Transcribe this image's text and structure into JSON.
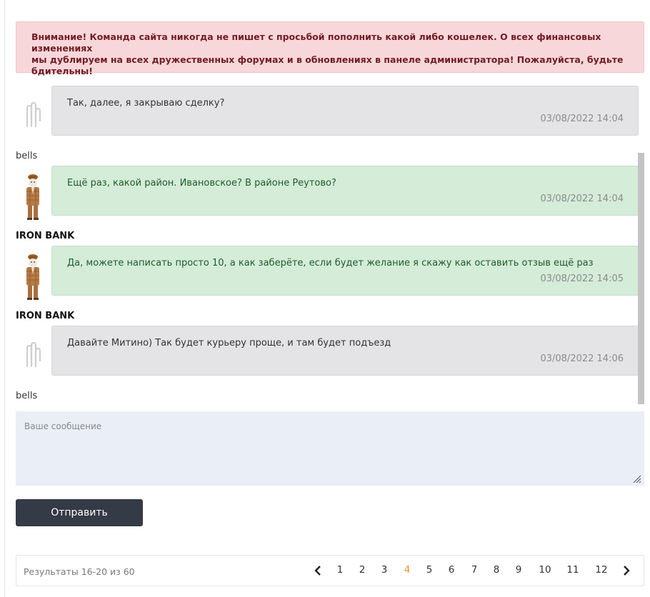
{
  "alert": {
    "line1": "Внимание! Команда сайта никогда не пишет с просьбой пополнить какой либо кошелек. О всех финансовых изменениях",
    "line2": "мы дублируем на всех дружественных форумах и в обновлениях в панеле администратора! Пожалуйста, будьте",
    "line3": "бдительны!"
  },
  "messages": [
    {
      "text": "Так, далее, я закрываю сделку?",
      "time": "03/08/2022 14:04",
      "author": "bells",
      "style": "grey"
    },
    {
      "text": "Ещё раз, какой район. Ивановское? В районе Реутово?",
      "time": "03/08/2022 14:04",
      "author": "IRON BANK",
      "style": "green"
    },
    {
      "text": "Да, можете написать просто 10, а как заберёте, если будет желание я скажу как оставить отзыв ещё раз",
      "time": "03/08/2022 14:05",
      "author": "IRON BANK",
      "style": "green"
    },
    {
      "text": "Давайте Митино) Так будет курьеру проще, и там будет подъезд",
      "time": "03/08/2022 14:06",
      "author": "bells",
      "style": "grey"
    }
  ],
  "composer": {
    "placeholder": "Ваше сообщение",
    "send_label": "Отправить"
  },
  "pagination": {
    "results": "Результаты 16-20 из 60",
    "pages": [
      "1",
      "2",
      "3",
      "4",
      "5",
      "6",
      "7",
      "8",
      "9",
      "10",
      "11",
      "12"
    ],
    "current": "4"
  },
  "colors": {
    "alert_bg": "#f8d7da",
    "alert_text": "#721c24",
    "bubble_grey": "#e4e4e6",
    "bubble_green": "#d4ecd8",
    "button_bg": "#343a46",
    "active_page": "#e8952a"
  }
}
